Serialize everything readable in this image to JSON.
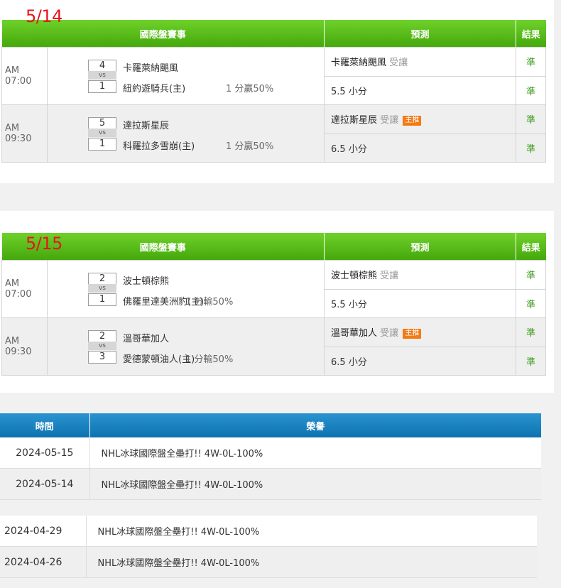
{
  "colors": {
    "green_header": "#55b616",
    "blue_header": "#1a82c0",
    "date_red": "#e8141b",
    "result_green": "#3c9b1c",
    "badge_orange": "#f27b16"
  },
  "headers": {
    "event": "國際盤賽事",
    "prediction": "預測",
    "result": "結果"
  },
  "days": [
    {
      "date": "5/14",
      "games": [
        {
          "time": "AM 07:00",
          "score_away": "4",
          "vs": "vs",
          "score_home": "1",
          "team_away": "卡羅萊納颶風",
          "team_home": "紐約遊騎兵(主)",
          "odds": "1 分贏50%",
          "pick_team": "卡羅萊納颶風",
          "pick_side": "受讓",
          "badge": "",
          "ou": "5.5 小分",
          "result1": "準",
          "result2": "準"
        },
        {
          "time": "AM 09:30",
          "score_away": "5",
          "vs": "vs",
          "score_home": "1",
          "team_away": "達拉斯星辰",
          "team_home": "科羅拉多雪崩(主)",
          "odds": "1 分贏50%",
          "pick_team": "達拉斯星辰",
          "pick_side": "受讓",
          "badge": "主推",
          "ou": "6.5 小分",
          "result1": "準",
          "result2": "準"
        }
      ]
    },
    {
      "date": "5/15",
      "games": [
        {
          "time": "AM 07:00",
          "score_away": "2",
          "vs": "vs",
          "score_home": "1",
          "team_away": "波士頓棕熊",
          "team_home": "佛羅里達美洲豹(主)",
          "odds": "1 分輸50%",
          "pick_team": "波士頓棕熊",
          "pick_side": "受讓",
          "badge": "",
          "ou": "5.5 小分",
          "result1": "準",
          "result2": "準"
        },
        {
          "time": "AM 09:30",
          "score_away": "2",
          "vs": "vs",
          "score_home": "3",
          "team_away": "溫哥華加人",
          "team_home": "愛德蒙頓油人(主)",
          "odds": "1 分輸50%",
          "pick_team": "溫哥華加人",
          "pick_side": "受讓",
          "badge": "主推",
          "ou": "6.5 小分",
          "result1": "準",
          "result2": "準"
        }
      ]
    }
  ],
  "honor": {
    "col_time": "時間",
    "col_honor": "榮譽",
    "rows": [
      {
        "date": "2024-05-15",
        "text": "NHL冰球國際盤全壘打!! 4W-0L-100%"
      },
      {
        "date": "2024-05-14",
        "text": "NHL冰球國際盤全壘打!! 4W-0L-100%"
      }
    ],
    "rows2": [
      {
        "date": "2024-04-29",
        "text": "NHL冰球國際盤全壘打!! 4W-0L-100%"
      },
      {
        "date": "2024-04-26",
        "text": "NHL冰球國際盤全壘打!! 4W-0L-100%"
      }
    ]
  }
}
